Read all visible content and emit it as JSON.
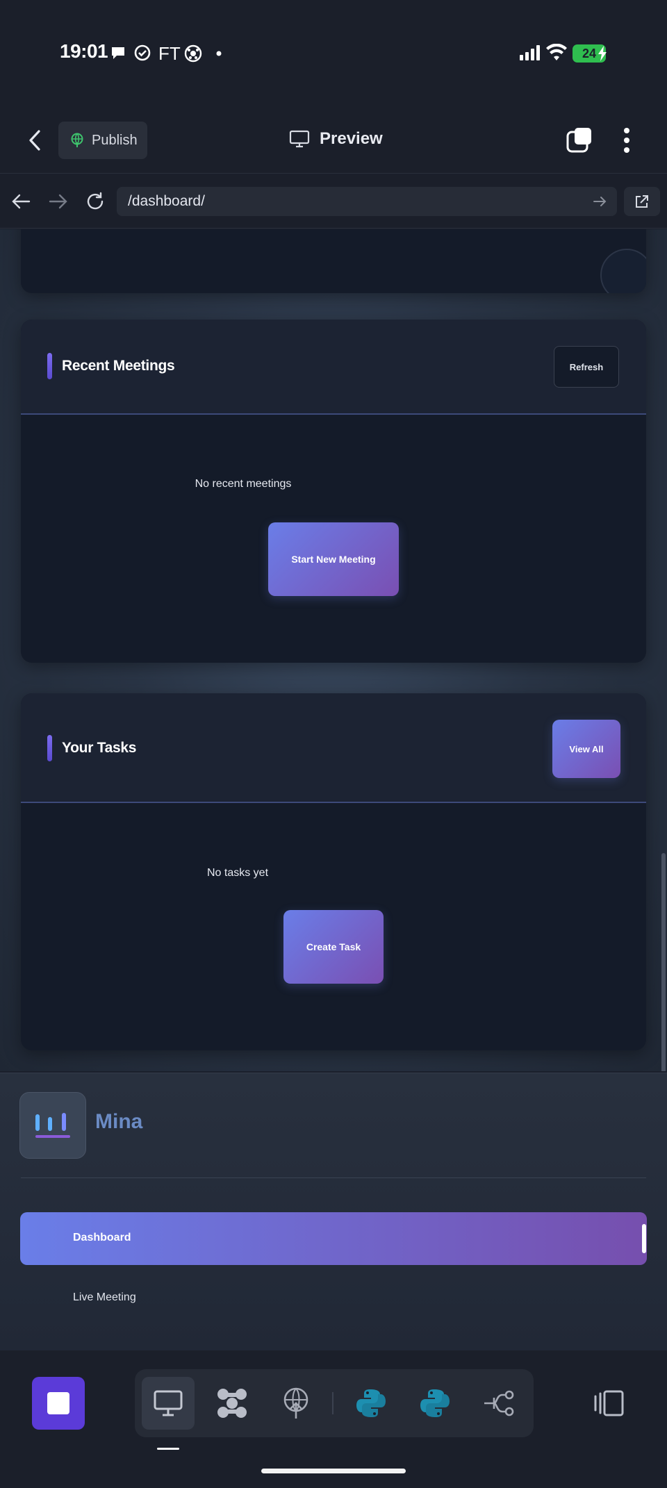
{
  "status_bar": {
    "time": "19:01",
    "ft": "FT",
    "battery": "24",
    "icons": [
      "chat-bubble-icon",
      "check-circle-icon",
      "soccer-ball-icon",
      "dot-icon",
      "signal-icon",
      "wifi-icon",
      "battery-icon",
      "charging-icon"
    ]
  },
  "toolbar": {
    "publish_label": "Publish",
    "preview_label": "Preview"
  },
  "browser": {
    "url": "/dashboard/"
  },
  "meetings_card": {
    "title": "Recent Meetings",
    "refresh_label": "Refresh",
    "empty_text": "No recent meetings",
    "cta_label": "Start New Meeting"
  },
  "tasks_card": {
    "title": "Your Tasks",
    "view_all_label": "View All",
    "empty_text": "No tasks yet",
    "cta_label": "Create Task"
  },
  "sidebar": {
    "brand": "Mina",
    "items": [
      {
        "label": "Dashboard",
        "active": true
      },
      {
        "label": "Live Meeting",
        "active": false
      }
    ]
  },
  "colors": {
    "accent_start": "#6a7ee8",
    "accent_end": "#764fae",
    "card_bg": "#141b29",
    "stop_button": "#5b3bd8",
    "python_blue": "#1d8fb0"
  }
}
